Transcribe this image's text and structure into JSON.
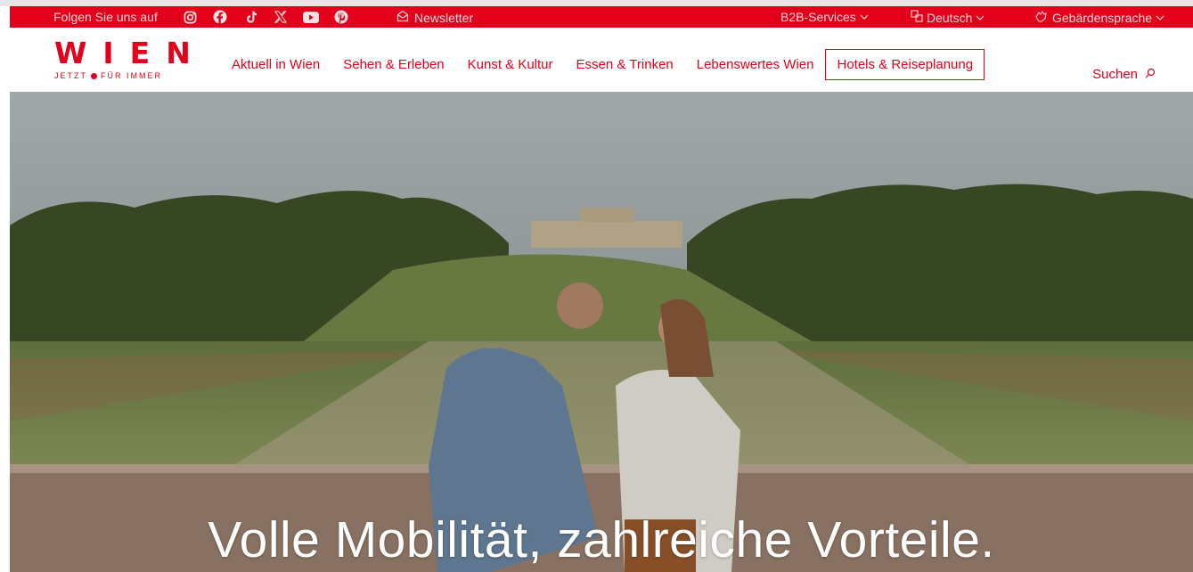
{
  "topbar": {
    "follow_label": "Folgen Sie uns auf",
    "social_icons": [
      "instagram-icon",
      "facebook-icon",
      "tiktok-icon",
      "x-icon",
      "youtube-icon",
      "pinterest-icon"
    ],
    "newsletter_label": "Newsletter",
    "b2b_label": "B2B-Services",
    "language_label": "Deutsch",
    "sign_language_label": "Gebärdensprache"
  },
  "logo": {
    "word": "WIEN",
    "tagline_left": "JETZT",
    "tagline_right": "FÜR IMMER"
  },
  "nav": {
    "items": [
      {
        "label": "Aktuell in Wien"
      },
      {
        "label": "Sehen & Erleben"
      },
      {
        "label": "Kunst & Kultur"
      },
      {
        "label": "Essen & Trinken"
      },
      {
        "label": "Lebenswertes Wien"
      },
      {
        "label": "Hotels & Reiseplanung"
      }
    ],
    "search_label": "Suchen"
  },
  "hero": {
    "title": "Volle Mobilität, zahlreiche Vorteile."
  },
  "colors": {
    "brand_red": "#e2001a",
    "hero_text": "#ffffff"
  }
}
